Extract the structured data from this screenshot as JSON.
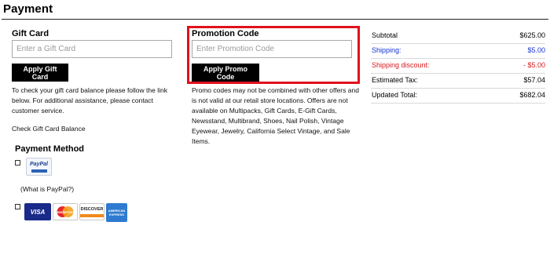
{
  "page": {
    "title": "Payment"
  },
  "gift_card": {
    "heading": "Gift Card",
    "placeholder": "Enter a Gift Card",
    "button": "Apply Gift Card",
    "help_text": "To check your gift card balance please follow the link below. For additional assistance, please contact customer service.",
    "balance_link": "Check Gift Card Balance"
  },
  "promotion": {
    "heading": "Promotion Code",
    "placeholder": "Enter Promotion Code",
    "button": "Apply Promo Code",
    "disclaimer": "Promo codes may not be combined with other offers and is not valid at our retail store locations. Offers are not available on Multipacks, Gift Cards, E-Gift Cards, Newsstand, Multibrand, Shoes, Nail Polish, Vintage Eyewear, Jewelry, California Select Vintage, and Sale Items."
  },
  "summary": {
    "subtotal_label": "Subtotal",
    "subtotal_value": "$625.00",
    "shipping_label": "Shipping:",
    "shipping_value": "$5.00",
    "discount_label": "Shipping discount:",
    "discount_value": "- $5.00",
    "tax_label": "Estimated Tax:",
    "tax_value": "$57.04",
    "total_label": "Updated Total:",
    "total_value": "$682.04"
  },
  "payment_method": {
    "heading": "Payment Method",
    "paypal_logo": "PayPal",
    "paypal_link": "(What is PayPal?)",
    "cards": {
      "visa": "VISA",
      "mastercard": "MasterCard",
      "discover": "DISCOVER",
      "amex": "AMERICAN EXPRESS"
    }
  },
  "colors": {
    "highlight": "#e1101c",
    "link_blue": "#1533d6",
    "discount_red": "#d7191c",
    "button_bg": "#000000"
  },
  "icons": [
    "paypal-logo-icon",
    "visa-card-icon",
    "mastercard-card-icon",
    "discover-card-icon",
    "amex-card-icon"
  ]
}
